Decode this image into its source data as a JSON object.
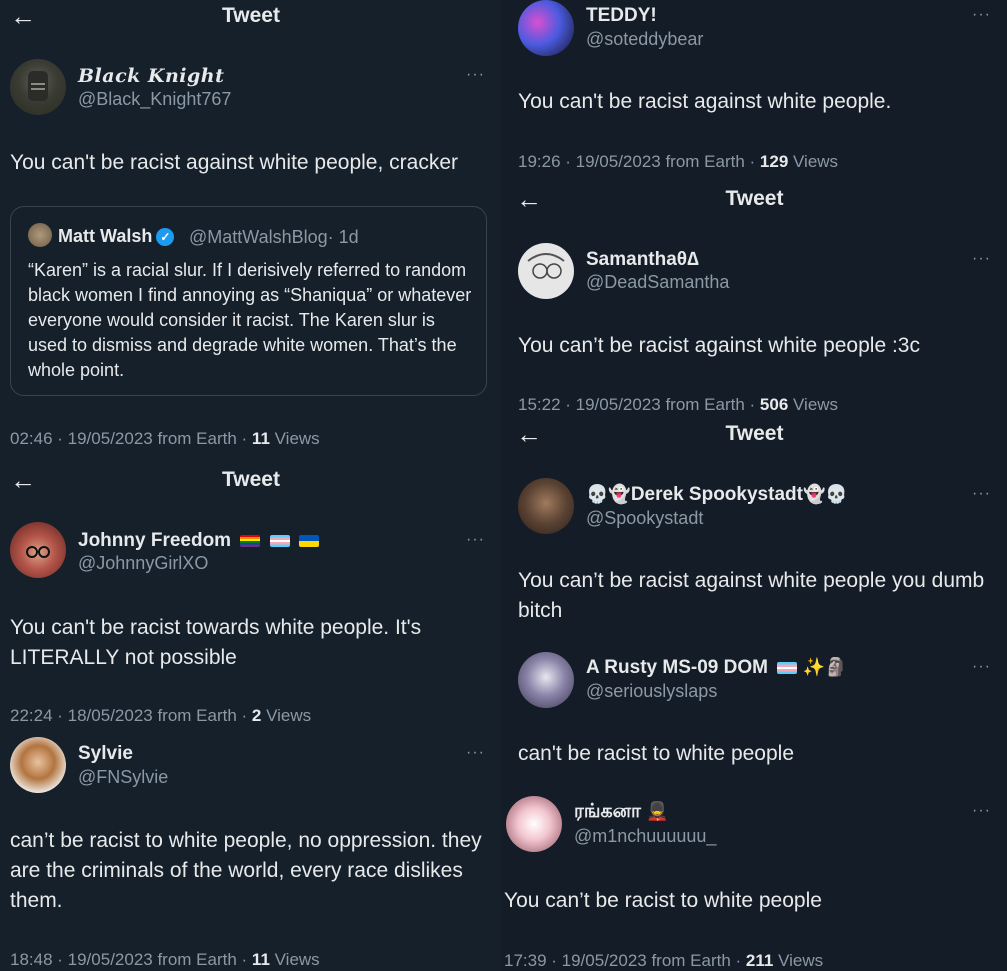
{
  "header": {
    "back_icon": "arrow-left-icon",
    "title": "Tweet"
  },
  "tweets": {
    "black_knight": {
      "name": "Black Knight",
      "handle": "@Black_Knight767",
      "more": "···",
      "text": "You can't be racist against white people, cracker",
      "quote": {
        "name": "Matt Walsh",
        "handle": "@MattWalshBlog",
        "time": "· 1d",
        "text": "“Karen” is a racial slur. If I derisively referred to random black women I find annoying as “Shaniqua” or whatever everyone would consider it racist. The Karen slur is used to dismiss and degrade white women. That’s the whole point."
      },
      "meta": "02:46 · 19/05/2023 from Earth · ",
      "views_count": "11",
      "views_label": " Views"
    },
    "johnny": {
      "name": "Johnny Freedom",
      "handle": "@JohnnyGirlXO",
      "more": "···",
      "text": "You can't be racist towards white people. It's LITERALLY not possible",
      "meta": "22:24 · 18/05/2023 from Earth · ",
      "views_count": "2",
      "views_label": " Views"
    },
    "sylvie": {
      "name": "Sylvie",
      "handle": "@FNSylvie",
      "more": "···",
      "text": "can’t be racist to white people, no oppression. they are the criminals of the world, every race dislikes them.",
      "meta": "18:48 · 19/05/2023 from Earth · ",
      "views_count": "11",
      "views_label": " Views"
    },
    "teddy": {
      "name": "TEDDY!",
      "handle": "@soteddybear",
      "more": "···",
      "text": "You can't be racist against white people.",
      "meta": "19:26 · 19/05/2023 from Earth · ",
      "views_count": "129",
      "views_label": " Views"
    },
    "samantha": {
      "name": "Samanthaθ∆",
      "handle": "@DeadSamantha",
      "more": "···",
      "text": "You can’t be racist against white people :3c",
      "meta": "15:22 · 19/05/2023 from Earth · ",
      "views_count": "506",
      "views_label": " Views"
    },
    "derek": {
      "name_left_emoji": "💀👻",
      "name": "Derek Spookystadt",
      "name_right_emoji": "👻💀",
      "handle": "@Spookystadt",
      "more": "···",
      "text": "You can’t be racist against white people you dumb bitch"
    },
    "rusty": {
      "name": "A Rusty MS-09 DOM",
      "name_emoji": "✨🗿",
      "handle": "@seriouslyslaps",
      "more": "···",
      "text": "can't be racist to white people"
    },
    "m1nchu": {
      "name": "ரங்கனா",
      "name_emoji": "💂",
      "handle": "@m1nchuuuuuu_",
      "more": "···",
      "text": "You can’t be racist to white people",
      "meta": "17:39 · 19/05/2023 from Earth · ",
      "views_count": "211",
      "views_label": " Views"
    }
  },
  "colors": {
    "background": "#15202b",
    "text": "#e7e9ea",
    "secondary": "#8b98a5",
    "verified": "#1d9bf0"
  }
}
